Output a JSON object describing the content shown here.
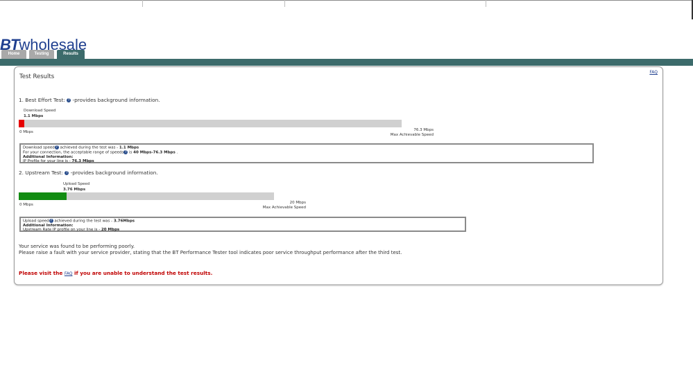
{
  "brand": {
    "logo_bt": "BT",
    "logo_wholesale": "wholesale"
  },
  "nav": {
    "tabs": [
      {
        "label": "Home"
      },
      {
        "label": "Testing"
      },
      {
        "label": "Results"
      }
    ],
    "active": "Results"
  },
  "panel": {
    "title": "Test Results",
    "faq_label": "FAQ"
  },
  "download": {
    "heading_prefix": "1. Best Effort Test: ",
    "heading_suffix": " -provides background information.",
    "info_icon": "question-icon",
    "label": "Download Speed",
    "value": "1.1 Mbps",
    "fraction": 0.0144,
    "min_label": "0 Mbps",
    "max_label": "76.3 Mbps",
    "max_caption": "Max Achievable Speed",
    "fill_color": "#e60000",
    "info": {
      "line1_a": "Download speed",
      "line1_b": " achieved during the test was - ",
      "line1_val": "1.1 Mbps",
      "line2_a": "For your connection, the acceptable range of speeds",
      "line2_b": " is ",
      "line2_val": "40 Mbps-76.3 Mbps",
      "line2_end": " .",
      "line3": "Additional Information:",
      "line4_a": "IP Profile for your line is - ",
      "line4_val": "76.3 Mbps"
    }
  },
  "upload": {
    "heading_prefix": "2. Upstream Test: ",
    "heading_suffix": " -provides background information.",
    "info_icon": "question-icon",
    "label": "Upload Speed",
    "value": "3.76 Mbps",
    "fraction": 0.188,
    "min_label": "0 Mbps",
    "max_label": "20 Mbps",
    "max_caption": "Max Achievable Speed",
    "fill_color": "#128c12",
    "info": {
      "line1_a": "Upload speed",
      "line1_b": " achieved during the test was - ",
      "line1_val": "3.76Mbps",
      "line2": "Additional Information:",
      "line3_a": "Upstream Rate IP profile on your line is - ",
      "line3_val": "20 Mbps"
    }
  },
  "summary": {
    "line1": "Your service was found to be performing poorly.",
    "line2": "Please raise a fault with your service provider, stating that the BT Performance Tester tool indicates poor service throughput performance after the third test."
  },
  "footer": {
    "prefix": "Please visit the ",
    "link": "FAQ",
    "suffix": " if you are unable to understand the test results."
  },
  "colors": {
    "accent": "#3c6b6b",
    "brand_blue": "#1f3f8f",
    "warning_red": "#c00000"
  }
}
